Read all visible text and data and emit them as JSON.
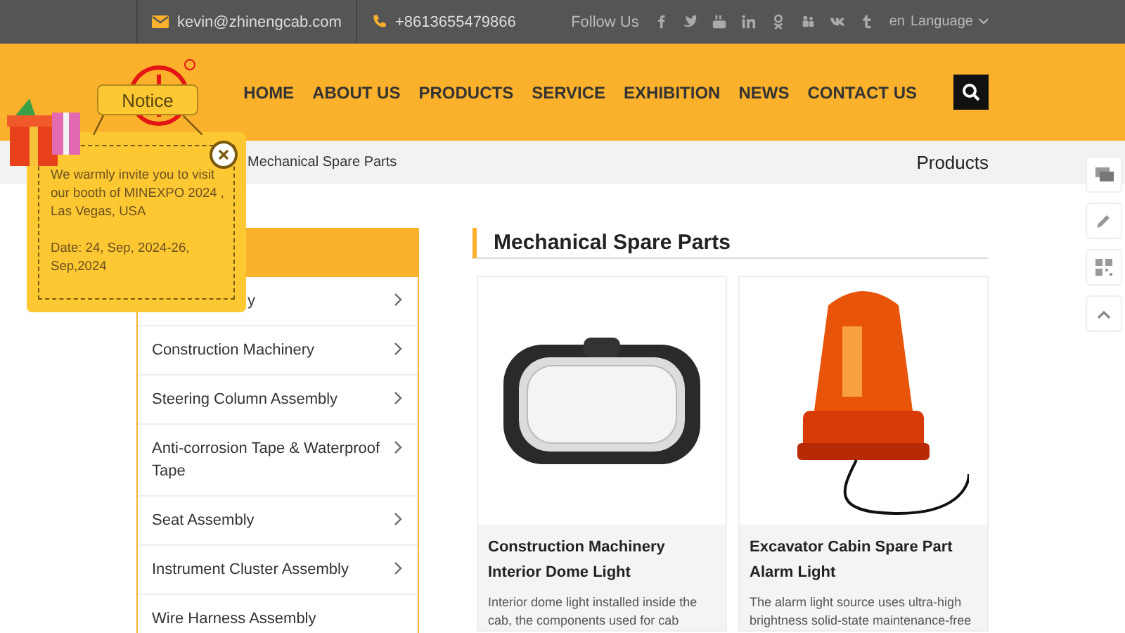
{
  "topbar": {
    "email": "kevin@zhinengcab.com",
    "phone": "+8613655479866",
    "follow_label": "Follow Us",
    "lang_code": "en",
    "language": "Language"
  },
  "nav": {
    "items": [
      {
        "label": "HOME",
        "selected": false
      },
      {
        "label": "ABOUT US",
        "selected": false
      },
      {
        "label": "PRODUCTS",
        "selected": false
      },
      {
        "label": "SERVICE",
        "selected": false
      },
      {
        "label": "EXHIBITION",
        "selected": false
      },
      {
        "label": "NEWS",
        "selected": false
      },
      {
        "label": "CONTACT US",
        "selected": false
      }
    ]
  },
  "breadcrumb": {
    "current": "Mechanical Spare Parts",
    "page_title": "Products"
  },
  "sidebar": {
    "items": [
      {
        "label": "y",
        "kind": "covered",
        "has_arrow": true
      },
      {
        "label": "Construction Machinery",
        "kind": "plain",
        "has_arrow": true
      },
      {
        "label": "Steering Column Assembly",
        "kind": "plain",
        "has_arrow": true
      },
      {
        "label": "Anti-corrosion Tape & Waterproof Tape",
        "kind": "plain",
        "has_arrow": true
      },
      {
        "label": "Seat Assembly",
        "kind": "plain",
        "has_arrow": true
      },
      {
        "label": "Instrument Cluster Assembly",
        "kind": "plain",
        "has_arrow": true
      },
      {
        "label": "Wire Harness Assembly",
        "kind": "plain",
        "has_arrow": false
      }
    ]
  },
  "section_title": "Mechanical Spare Parts",
  "products": [
    {
      "kind": "dome-light",
      "title": "Construction Machinery Interior Dome Light",
      "description": "Interior dome light installed inside the cab, the components used for cab"
    },
    {
      "kind": "beacon",
      "title": "Excavator Cabin Spare Part Alarm Light",
      "description": "The alarm light source uses ultra-high brightness solid-state maintenance-free"
    }
  ],
  "notice": {
    "label": "Notice",
    "message": "We warmly invite you to visit our booth of MINEXPO 2024 , Las Vegas, USA",
    "date": "Date: 24, Sep, 2024-26, Sep,2024"
  }
}
